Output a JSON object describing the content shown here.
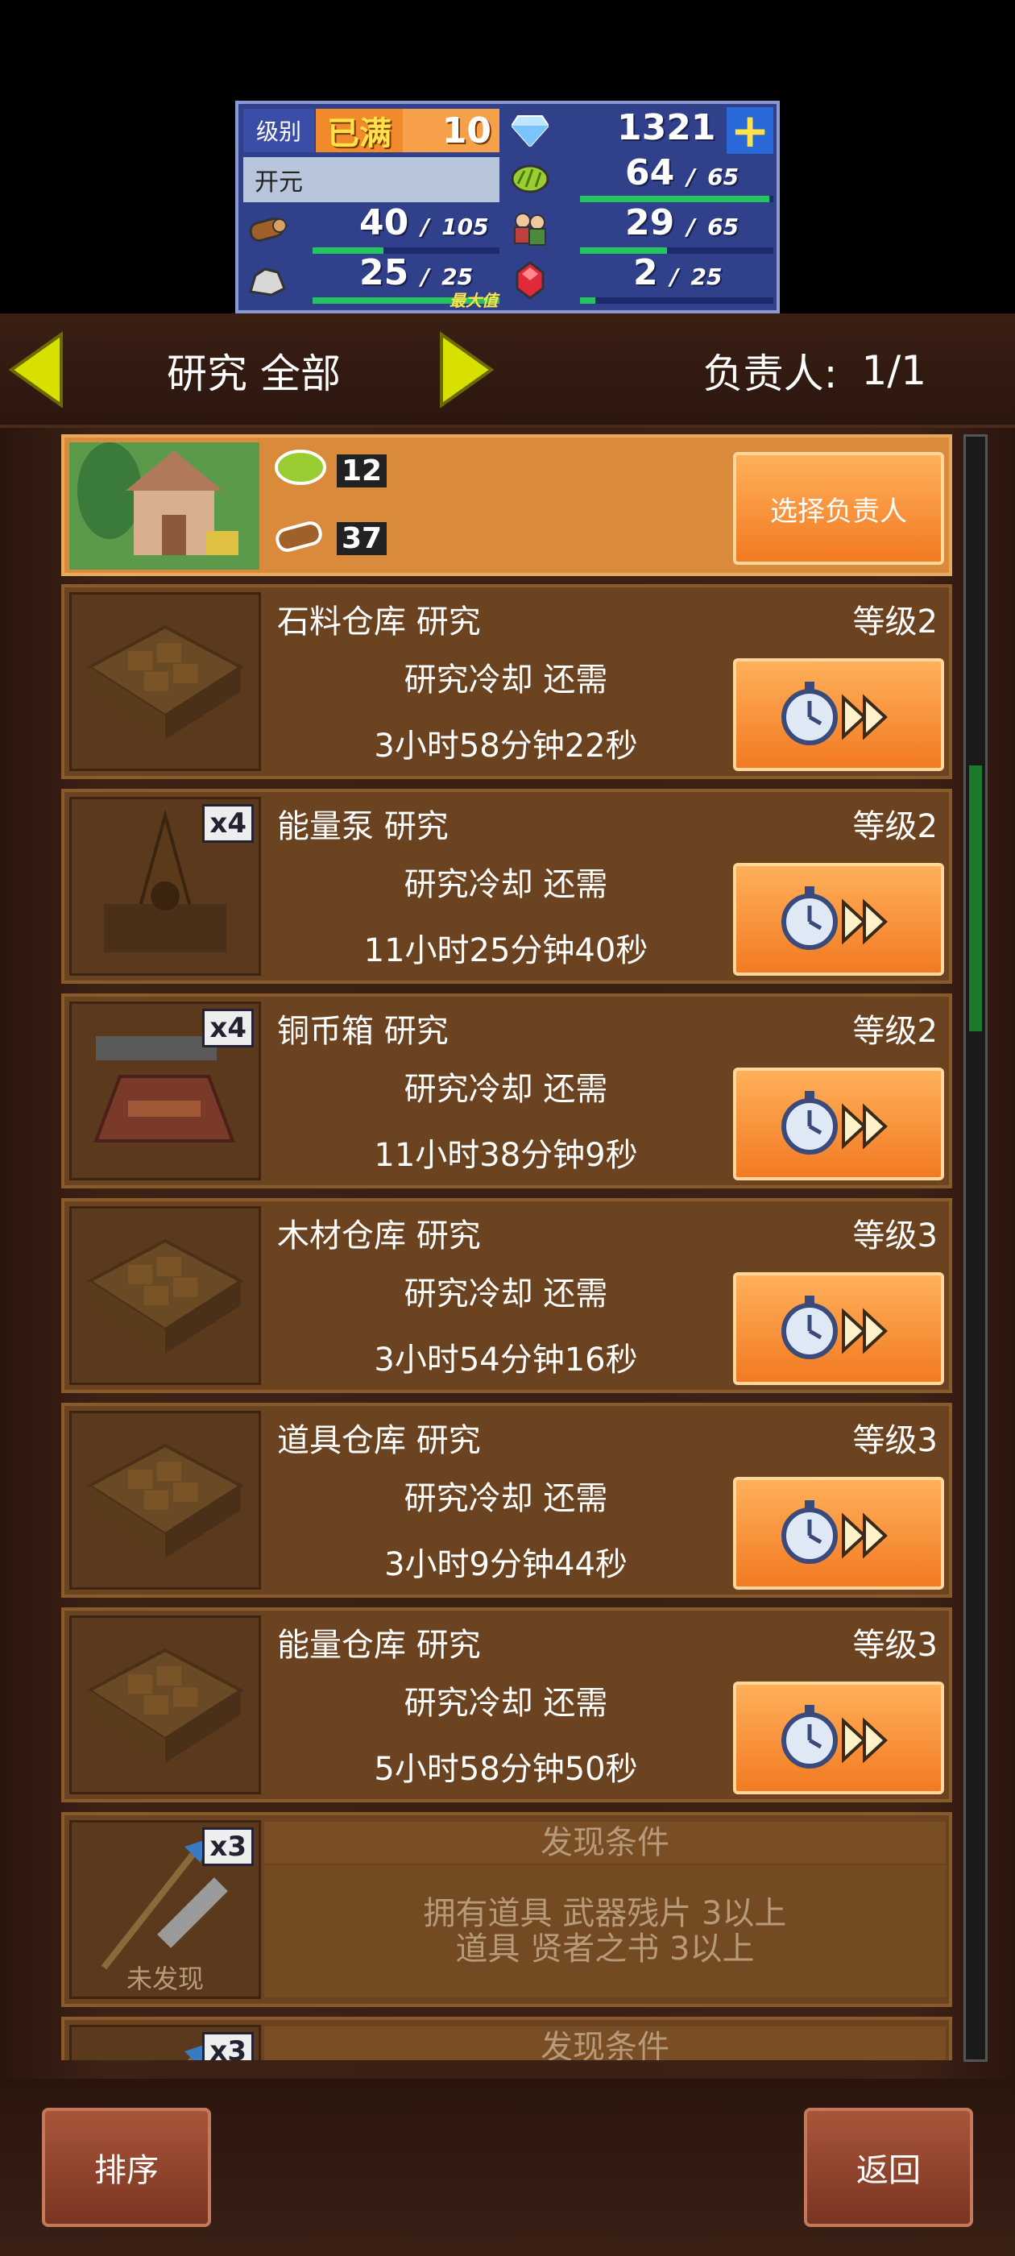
{
  "stats": {
    "level_label": "级别",
    "level_status": "已满",
    "level_value": "10",
    "gems": "1321",
    "name": "开元",
    "food": "64",
    "food_max": "65",
    "wood": "40",
    "wood_max": "105",
    "people": "29",
    "people_max": "65",
    "stone": "25",
    "stone_max": "25",
    "stone_tag": "最大值",
    "red": "2",
    "red_max": "25",
    "separator": "/"
  },
  "header": {
    "title": "研究 全部",
    "owner_label": "负责人:",
    "owner_value": "1/1"
  },
  "top_card": {
    "res_1": "12",
    "res_2": "37",
    "button": "选择负责人"
  },
  "cards": [
    {
      "title": "石料仓库 研究",
      "level": "等级2",
      "line1": "研究冷却 还需",
      "line2": "3小时58分钟22秒",
      "badge": ""
    },
    {
      "title": "能量泵 研究",
      "level": "等级2",
      "line1": "研究冷却 还需",
      "line2": "11小时25分钟40秒",
      "badge": "x4"
    },
    {
      "title": "铜币箱 研究",
      "level": "等级2",
      "line1": "研究冷却 还需",
      "line2": "11小时38分钟9秒",
      "badge": "x4"
    },
    {
      "title": "木材仓库 研究",
      "level": "等级3",
      "line1": "研究冷却 还需",
      "line2": "3小时54分钟16秒",
      "badge": ""
    },
    {
      "title": "道具仓库 研究",
      "level": "等级3",
      "line1": "研究冷却 还需",
      "line2": "3小时9分钟44秒",
      "badge": ""
    },
    {
      "title": "能量仓库 研究",
      "level": "等级3",
      "line1": "研究冷却 还需",
      "line2": "5小时58分钟50秒",
      "badge": ""
    }
  ],
  "locked": [
    {
      "cond": "发现条件",
      "req1": "拥有道具 武器残片 3以上",
      "req2": "道具 贤者之书 3以上",
      "status": "未发现",
      "badge": "x3"
    },
    {
      "cond": "发现条件",
      "req1": "",
      "req2": "",
      "status": "",
      "badge": "x3"
    }
  ],
  "bottom": {
    "sort": "排序",
    "back": "返回"
  },
  "colors": {
    "accent_orange": "#f27a22",
    "panel_blue": "#30408a",
    "bar_green": "#22c55e",
    "arrow_yellow": "#d8e000"
  }
}
